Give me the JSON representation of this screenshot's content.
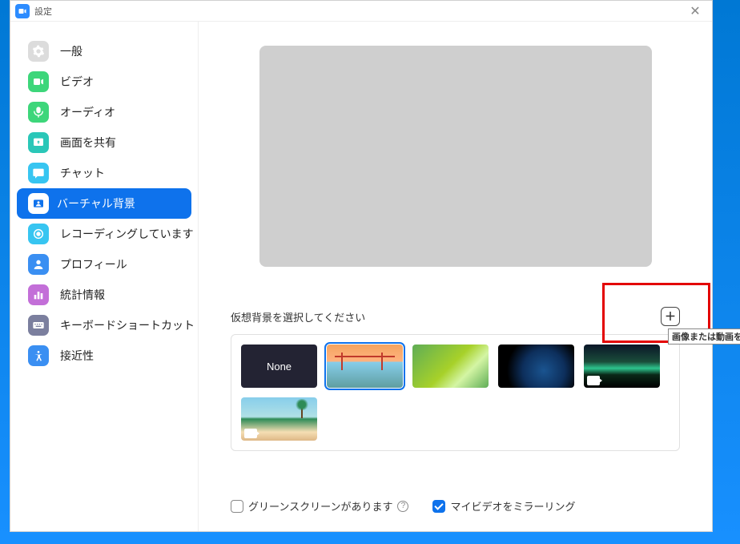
{
  "window": {
    "title": "設定"
  },
  "sidebar": {
    "items": [
      {
        "label": "一般",
        "icon": "gear",
        "color": "#dcdcdc"
      },
      {
        "label": "ビデオ",
        "icon": "video",
        "color": "#3dd67a"
      },
      {
        "label": "オーディオ",
        "icon": "audio",
        "color": "#3dd67a"
      },
      {
        "label": "画面を共有",
        "icon": "share",
        "color": "#2ac7b8"
      },
      {
        "label": "チャット",
        "icon": "chat",
        "color": "#37c5f1"
      },
      {
        "label": "バーチャル背景",
        "icon": "vbg",
        "color": "#0e72ec",
        "active": true
      },
      {
        "label": "レコーディングしています",
        "icon": "record",
        "color": "#37c5f1"
      },
      {
        "label": "プロフィール",
        "icon": "profile",
        "color": "#3a8ff2"
      },
      {
        "label": "統計情報",
        "icon": "stats",
        "color": "#c36fd8"
      },
      {
        "label": "キーボードショートカット",
        "icon": "keyboard",
        "color": "#7b7f9e"
      },
      {
        "label": "接近性",
        "icon": "access",
        "color": "#3a8ff2"
      }
    ]
  },
  "main": {
    "section_label": "仮想背景を選択してください",
    "add_tooltip": "画像または動画を追加",
    "thumbs": {
      "none_label": "None"
    },
    "options": {
      "greenscreen": "グリーンスクリーンがあります",
      "mirror": "マイビデオをミラーリング"
    }
  }
}
